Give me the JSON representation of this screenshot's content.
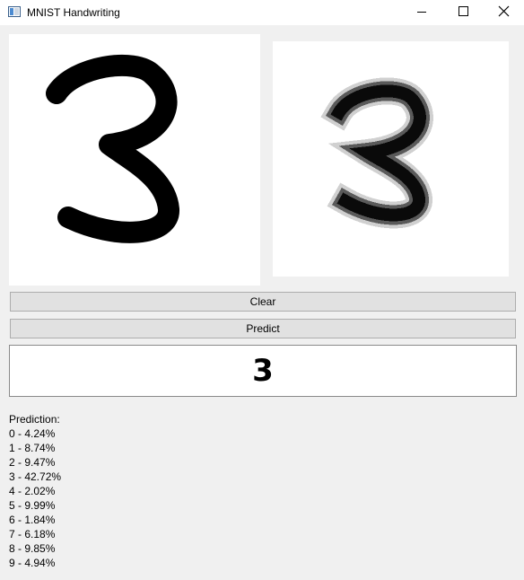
{
  "window": {
    "title": "MNIST Handwriting",
    "icon": "app-window-icon",
    "controls": [
      "minimize-icon",
      "maximize-icon",
      "close-icon"
    ]
  },
  "canvas": {
    "drawn_digit": "3"
  },
  "preview": {
    "digit": "3"
  },
  "buttons": {
    "clear_label": "Clear",
    "predict_label": "Predict"
  },
  "result": {
    "digit": "3"
  },
  "prediction": {
    "heading": "Prediction:",
    "items": [
      {
        "digit": "0",
        "percent": "4.24%",
        "text": "0 - 4.24%"
      },
      {
        "digit": "1",
        "percent": "8.74%",
        "text": "1 - 8.74%"
      },
      {
        "digit": "2",
        "percent": "9.47%",
        "text": "2 - 9.47%"
      },
      {
        "digit": "3",
        "percent": "42.72%",
        "text": "3 - 42.72%"
      },
      {
        "digit": "4",
        "percent": "2.02%",
        "text": "4 - 2.02%"
      },
      {
        "digit": "5",
        "percent": "9.99%",
        "text": "5 - 9.99%"
      },
      {
        "digit": "6",
        "percent": "1.84%",
        "text": "6 - 1.84%"
      },
      {
        "digit": "7",
        "percent": "6.18%",
        "text": "7 - 6.18%"
      },
      {
        "digit": "8",
        "percent": "9.85%",
        "text": "8 - 9.85%"
      },
      {
        "digit": "9",
        "percent": "4.94%",
        "text": "9 - 4.94%"
      }
    ]
  },
  "colors": {
    "window_bg": "#f0f0f0",
    "canvas_bg": "#ffffff",
    "ink": "#000000",
    "button_bg": "#e1e1e1",
    "button_border": "#adadad"
  }
}
